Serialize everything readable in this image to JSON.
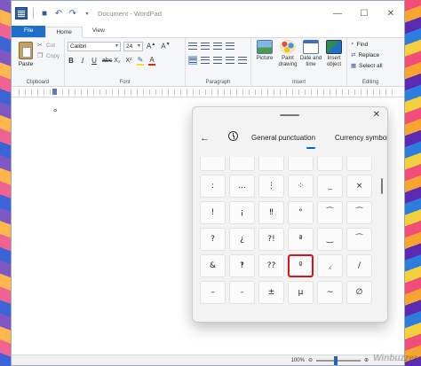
{
  "window": {
    "title": "Document - WordPad"
  },
  "tabs": [
    "File",
    "Home",
    "View"
  ],
  "ribbon": {
    "clipboard": {
      "label": "Clipboard",
      "paste": "Paste",
      "cut": "Cut",
      "copy": "Copy"
    },
    "font": {
      "label": "Font",
      "family": "Calibri",
      "size": "24"
    },
    "paragraph": {
      "label": "Paragraph"
    },
    "insert": {
      "label": "Insert",
      "picture": "Picture",
      "paint": "Paint\ndrawing",
      "datetime": "Date and\ntime",
      "object": "Insert\nobject"
    },
    "editing": {
      "label": "Editing",
      "find": "Find",
      "replace": "Replace",
      "select_all": "Select all"
    }
  },
  "document": {
    "text": "°"
  },
  "statusbar": {
    "zoom": "100%"
  },
  "emoji_panel": {
    "tab_active": "General punctuation",
    "tab_next": "Currency symbols",
    "symbols": [
      "",
      "",
      "",
      "",
      "",
      "",
      ":",
      "...",
      "⋮",
      "⁘",
      "_",
      "×",
      "!",
      "¡",
      "‼",
      "°",
      "⁀",
      "⁀",
      "?",
      "¿",
      "?!",
      "ª",
      "‿",
      "⁀",
      "&",
      "‽",
      "??",
      "º",
      "⁁",
      "/",
      "–",
      "-",
      "±",
      "μ",
      "~",
      "∅"
    ],
    "highlighted_index": 27
  },
  "watermark": "Winbuzzer"
}
